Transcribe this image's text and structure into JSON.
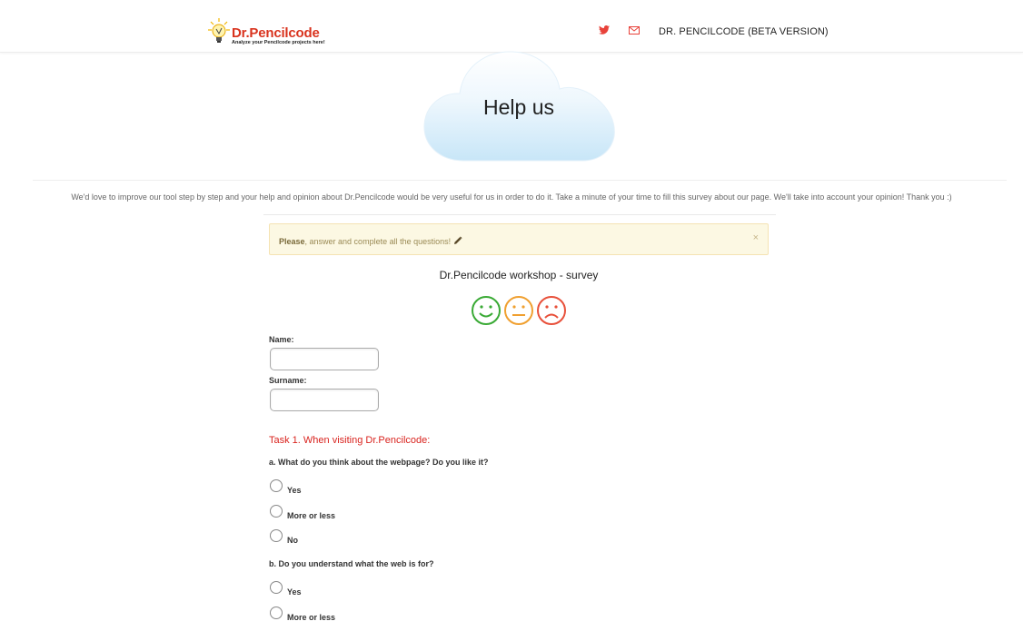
{
  "header": {
    "logo_text": "Dr.Pencilcode",
    "logo_tagline": "Analyze your Pencilcode projects here!",
    "icons": [
      "twitter-icon",
      "mail-icon"
    ],
    "title": "DR. PENCILCODE (BETA VERSION)"
  },
  "hero": {
    "title": "Help us"
  },
  "intro": "We'd love to improve our tool step by step and your help and opinion about Dr.Pencilcode would be very useful for us in order to do it. Take a minute of your time to fill this survey about our page. We'll take into account your opinion! Thank you :)",
  "alert": {
    "strong": "Please",
    "text": ", answer and complete all the questions!",
    "close": "×"
  },
  "survey": {
    "title": "Dr.Pencilcode workshop - survey",
    "smileys": [
      "happy-face-icon",
      "neutral-face-icon",
      "sad-face-icon"
    ],
    "name_label": "Name:",
    "name_value": "",
    "surname_label": "Surname:",
    "surname_value": "",
    "task1": {
      "title": "Task 1. When visiting Dr.Pencilcode:",
      "q_a": {
        "text": "a. What do you think about the webpage? Do you like it?",
        "options": [
          "Yes",
          "More or less",
          "No"
        ]
      },
      "q_b": {
        "text": "b. Do you understand what the web is for?",
        "options": [
          "Yes",
          "More or less"
        ]
      }
    }
  },
  "colors": {
    "accent_red": "#d9231e",
    "alert_bg": "#fcf8e3",
    "smiley_green": "#3aaa35",
    "smiley_orange": "#f0a030",
    "smiley_red": "#e8503a",
    "cloud_blue": "#cde8f8"
  }
}
